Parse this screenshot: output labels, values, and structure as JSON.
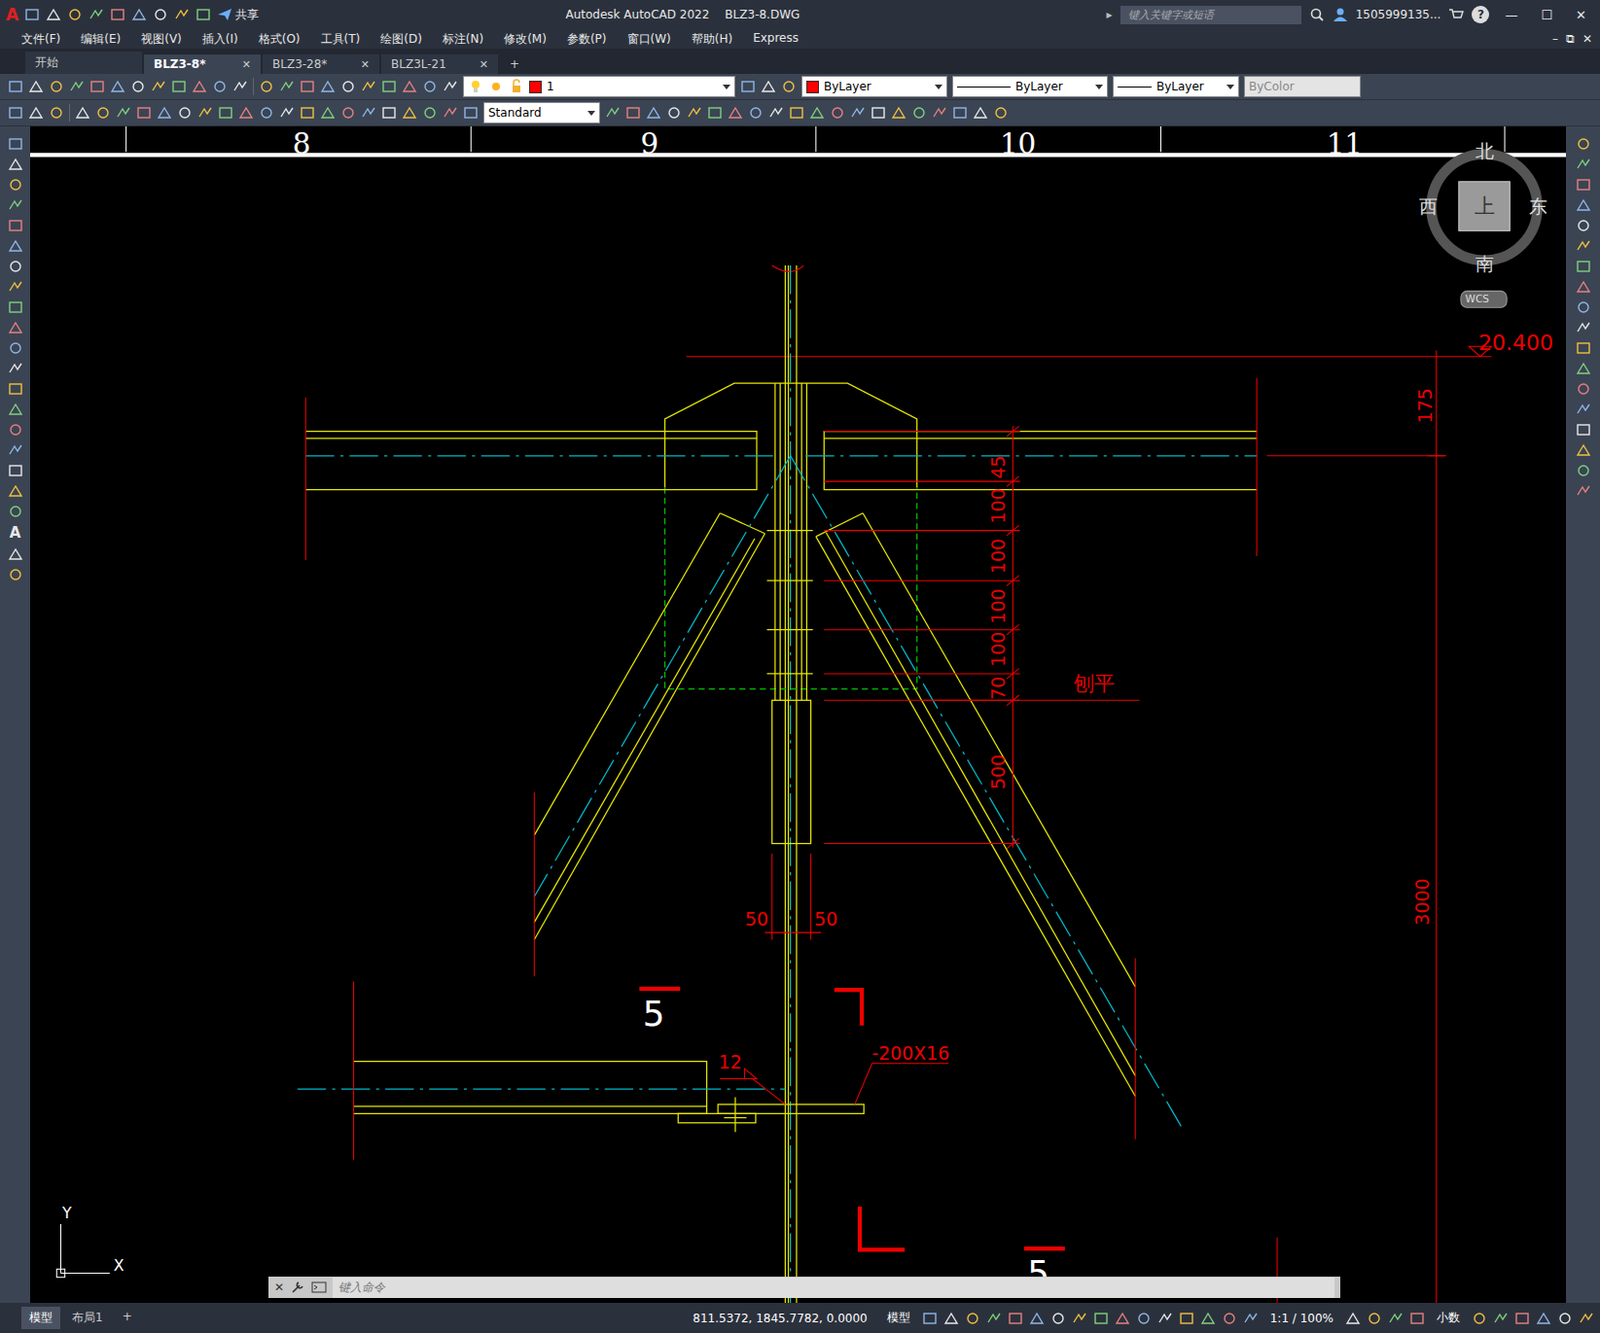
{
  "window": {
    "title": "Autodesk AutoCAD 2022",
    "file": "BLZ3-8.DWG",
    "logo": "A",
    "share": "共享",
    "controls": [
      "—",
      "☐",
      "✕"
    ],
    "help": "?"
  },
  "search": {
    "placeholder": "键入关键字或短语",
    "arrow": "▸"
  },
  "user": "1505999135...",
  "menu": [
    "文件(F)",
    "编辑(E)",
    "视图(V)",
    "插入(I)",
    "格式(O)",
    "工具(T)",
    "绘图(D)",
    "标注(N)",
    "修改(M)",
    "参数(P)",
    "窗口(W)",
    "帮助(H)",
    "Express"
  ],
  "doc_controls": [
    "–",
    "⧉",
    "✕"
  ],
  "doc_tabs": [
    {
      "label": "开始",
      "selected": false,
      "closable": false
    },
    {
      "label": "BLZ3-8*",
      "selected": true,
      "closable": true
    },
    {
      "label": "BLZ3-28*",
      "selected": false,
      "closable": true
    },
    {
      "label": "BLZ3L-21",
      "selected": false,
      "closable": true
    }
  ],
  "tab_close": "✕",
  "add_tab": "+",
  "properties": {
    "layer": "1",
    "layer_color": "#ff0000",
    "color": "ByLayer",
    "linetype": "ByLayer",
    "lineweight": "ByLayer",
    "plotstyle": "ByColor"
  },
  "text_style": "Standard",
  "left_toolbar": {
    "text_tool": "A"
  },
  "viewcube": {
    "north": "北",
    "south": "南",
    "east": "东",
    "west": "西",
    "face": "上",
    "ucs": "WCS"
  },
  "drawing": {
    "grid_labels": [
      "8",
      "9",
      "10",
      "11"
    ],
    "elevation": "20.400",
    "dimensions": [
      "175",
      "45",
      "100",
      "100",
      "100",
      "100",
      "70",
      "500",
      "3000",
      "50",
      "50",
      "12"
    ],
    "note": "刨平",
    "plate": "-200X16",
    "sections": [
      "5",
      "5"
    ],
    "axes": {
      "x": "X",
      "y": "Y"
    }
  },
  "command": {
    "placeholder": "键入命令"
  },
  "layout_tabs": [
    {
      "label": "模型",
      "selected": true
    },
    {
      "label": "布局1",
      "selected": false
    }
  ],
  "add_layout": "+",
  "status": {
    "coords": "811.5372, 1845.7782, 0.0000",
    "space": "模型",
    "scale": "1:1 / 100%",
    "units": "小数"
  }
}
